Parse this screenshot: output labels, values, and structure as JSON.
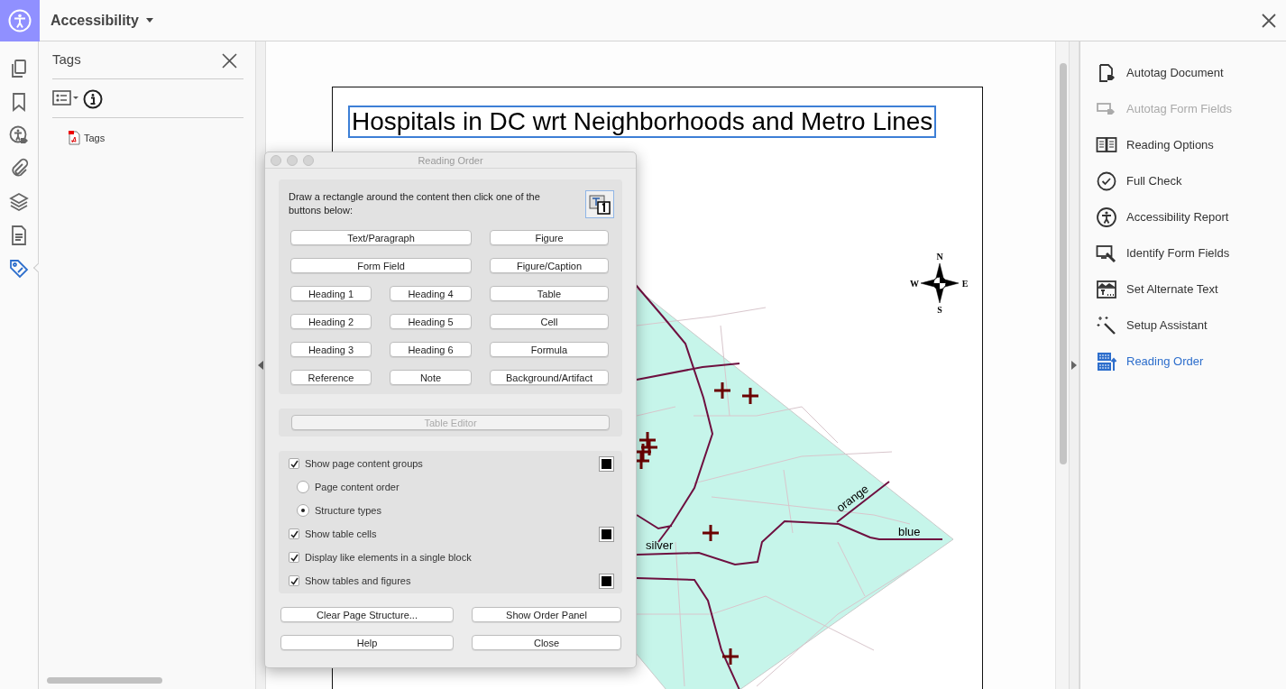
{
  "app": {
    "title": "Accessibility"
  },
  "left_rail": [
    {
      "selected": false
    },
    {
      "selected": false
    },
    {
      "selected": false
    },
    {
      "selected": false
    },
    {
      "selected": false
    },
    {
      "selected": false
    },
    {
      "selected": true
    }
  ],
  "tags_panel": {
    "title": "Tags",
    "tree": [
      {
        "label": "Tags"
      }
    ]
  },
  "document": {
    "title": "Hospitals in DC wrt Neighborhoods and Metro Lines",
    "map_labels": [
      "silver",
      "orange",
      "blue"
    ],
    "compass": {
      "north": "N",
      "west": "W",
      "east": "E",
      "south": "S"
    }
  },
  "reading_order_dialog": {
    "title": "Reading Order",
    "instruction": "Draw a rectangle around the content then click one of the buttons below:",
    "button_rows": [
      [
        "Text/Paragraph",
        "Figure"
      ],
      [
        "Form Field",
        "Figure/Caption"
      ],
      [
        "Heading 1",
        "Heading 4",
        "Table"
      ],
      [
        "Heading 2",
        "Heading 5",
        "Cell"
      ],
      [
        "Heading 3",
        "Heading 6",
        "Formula"
      ],
      [
        "Reference",
        "Note",
        "Background/Artifact"
      ]
    ],
    "table_editor": {
      "label": "Table Editor",
      "disabled": true
    },
    "options": [
      {
        "kind": "checkbox",
        "label": "Show page content groups",
        "checked": true,
        "swatch": true
      },
      {
        "kind": "radio",
        "label": "Page content order",
        "selected": false
      },
      {
        "kind": "radio",
        "label": "Structure types",
        "selected": true
      },
      {
        "kind": "checkbox",
        "label": "Show table cells",
        "checked": true,
        "swatch": true
      },
      {
        "kind": "checkbox",
        "label": "Display like elements in a single block",
        "checked": true,
        "swatch": false
      },
      {
        "kind": "checkbox",
        "label": "Show tables and figures",
        "checked": true,
        "swatch": true
      }
    ],
    "footer_buttons": [
      "Clear Page Structure...",
      "Show Order Panel",
      "Help",
      "Close"
    ]
  },
  "tools": [
    {
      "label": "Autotag Document",
      "disabled": false,
      "selected": false
    },
    {
      "label": "Autotag Form Fields",
      "disabled": true,
      "selected": false
    },
    {
      "label": "Reading Options",
      "disabled": false,
      "selected": false
    },
    {
      "label": "Full Check",
      "disabled": false,
      "selected": false
    },
    {
      "label": "Accessibility Report",
      "disabled": false,
      "selected": false
    },
    {
      "label": "Identify Form Fields",
      "disabled": false,
      "selected": false
    },
    {
      "label": "Set Alternate Text",
      "disabled": false,
      "selected": false
    },
    {
      "label": "Setup Assistant",
      "disabled": false,
      "selected": false
    },
    {
      "label": "Reading Order",
      "disabled": false,
      "selected": true
    }
  ]
}
